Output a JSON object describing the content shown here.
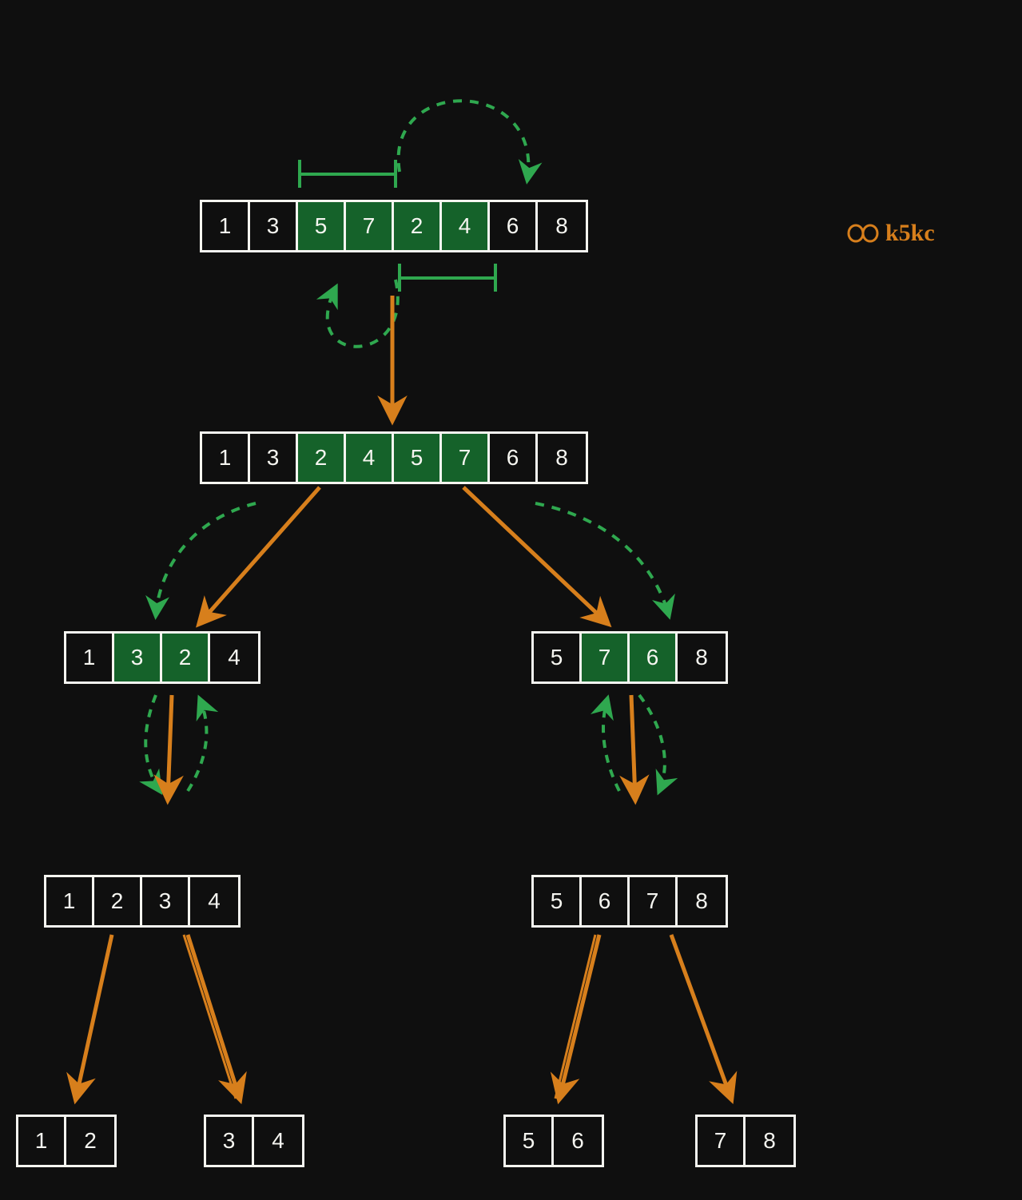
{
  "colors": {
    "bg": "#0f0f0f",
    "cell_border": "#f5f5f0",
    "cell_text": "#f5f5f0",
    "highlight": "#15622a",
    "arrow_orange": "#d77f1c",
    "arrow_green": "#2fa84f"
  },
  "watermark": {
    "text": "k5kc"
  },
  "arrays": {
    "level1": {
      "values": [
        "1",
        "3",
        "5",
        "7",
        "2",
        "4",
        "6",
        "8"
      ],
      "highlight": [
        2,
        3,
        4,
        5
      ]
    },
    "level2": {
      "values": [
        "1",
        "3",
        "2",
        "4",
        "5",
        "7",
        "6",
        "8"
      ],
      "highlight": [
        2,
        3,
        4,
        5
      ]
    },
    "level3_L": {
      "values": [
        "1",
        "3",
        "2",
        "4"
      ],
      "highlight": [
        1,
        2
      ]
    },
    "level3_R": {
      "values": [
        "5",
        "7",
        "6",
        "8"
      ],
      "highlight": [
        1,
        2
      ]
    },
    "level4_L": {
      "values": [
        "1",
        "2",
        "3",
        "4"
      ],
      "highlight": []
    },
    "level4_R": {
      "values": [
        "5",
        "6",
        "7",
        "8"
      ],
      "highlight": []
    },
    "level5_LL": {
      "values": [
        "1",
        "2"
      ],
      "highlight": []
    },
    "level5_LR": {
      "values": [
        "3",
        "4"
      ],
      "highlight": []
    },
    "level5_RL": {
      "values": [
        "5",
        "6"
      ],
      "highlight": []
    },
    "level5_RR": {
      "values": [
        "7",
        "8"
      ],
      "highlight": []
    }
  },
  "brackets": {
    "top": {
      "over_indices": [
        2,
        3
      ],
      "of_array": "level1"
    },
    "bottom": {
      "over_indices": [
        4,
        5
      ],
      "of_array": "level1"
    }
  },
  "swap_arrows": {
    "level1": {
      "top_dashed_green": true,
      "bottom_dashed_green": true
    },
    "level2_to_3": {
      "left_dashed_green": true,
      "right_dashed_green": true
    },
    "level3_to_4": {
      "left_small_dashed_green_pair": true,
      "right_small_dashed_green_pair": true
    }
  },
  "flow_arrows_orange": [
    "level1->level2",
    "level2->level3_L",
    "level2->level3_R",
    "level3_L->level4_L",
    "level3_R->level4_R",
    "level4_L->level5_LL",
    "level4_L->level5_LR",
    "level4_R->level5_RL",
    "level4_R->level5_RR"
  ]
}
